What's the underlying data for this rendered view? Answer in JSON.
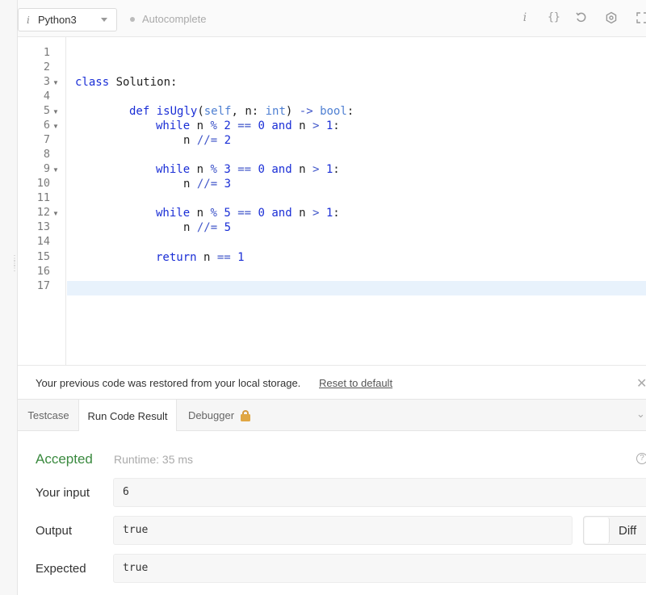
{
  "toolbar": {
    "language": "Python3",
    "autocomplete_label": "Autocomplete",
    "icons": [
      "info-icon",
      "braces-icon",
      "undo-icon",
      "settings-icon",
      "fullscreen-icon"
    ]
  },
  "editor": {
    "line_numbers": [
      "1",
      "2",
      "3",
      "4",
      "5",
      "6",
      "7",
      "8",
      "9",
      "10",
      "11",
      "12",
      "13",
      "14",
      "15",
      "16",
      "17"
    ],
    "folded_lines": [
      "3",
      "5",
      "6",
      "9",
      "12"
    ],
    "code": {
      "l3_kw": "class",
      "l3_name": "Solution:",
      "l5_kw": "def",
      "l5_fn": "isUgly",
      "l5_a": "(",
      "l5_self": "self",
      "l5_b": ", n: ",
      "l5_int": "int",
      "l5_c": ") ",
      "l5_arrow": "->",
      "l5_sp": " ",
      "l5_bool": "bool",
      "l5_colon": ":",
      "l6_while": "while",
      "l6_a": " n ",
      "l6_mod": "%",
      "l6_sp1": " ",
      "l6_two": "2",
      "l6_sp2": " ",
      "l6_eq": "==",
      "l6_sp3": " ",
      "l6_zero": "0",
      "l6_sp4": " ",
      "l6_and": "and",
      "l6_b": " n ",
      "l6_gt": ">",
      "l6_sp5": " ",
      "l6_one": "1",
      "l6_colon": ":",
      "l7_n": "n ",
      "l7_op": "//=",
      "l7_sp": " ",
      "l7_val": "2",
      "l9_while": "while",
      "l9_a": " n ",
      "l9_mod": "%",
      "l9_sp1": " ",
      "l9_three": "3",
      "l9_sp2": " ",
      "l9_eq": "==",
      "l9_sp3": " ",
      "l9_zero": "0",
      "l9_sp4": " ",
      "l9_and": "and",
      "l9_b": " n ",
      "l9_gt": ">",
      "l9_sp5": " ",
      "l9_one": "1",
      "l9_colon": ":",
      "l10_n": "n ",
      "l10_op": "//=",
      "l10_sp": " ",
      "l10_val": "3",
      "l12_while": "while",
      "l12_a": " n ",
      "l12_mod": "%",
      "l12_sp1": " ",
      "l12_five": "5",
      "l12_sp2": " ",
      "l12_eq": "==",
      "l12_sp3": " ",
      "l12_zero": "0",
      "l12_sp4": " ",
      "l12_and": "and",
      "l12_b": " n ",
      "l12_gt": ">",
      "l12_sp5": " ",
      "l12_one": "1",
      "l12_colon": ":",
      "l13_n": "n ",
      "l13_op": "//=",
      "l13_sp": " ",
      "l13_val": "5",
      "l15_return": "return",
      "l15_a": " n ",
      "l15_eq": "==",
      "l15_sp": " ",
      "l15_one": "1"
    }
  },
  "notice": {
    "text": "Your previous code was restored from your local storage.",
    "reset_link": "Reset to default"
  },
  "tabs": {
    "items": [
      {
        "label": "Testcase",
        "active": false
      },
      {
        "label": "Run Code Result",
        "active": true
      },
      {
        "label": "Debugger",
        "active": false,
        "locked": true
      }
    ]
  },
  "result": {
    "status": "Accepted",
    "status_color": "#3a8a3f",
    "runtime": "Runtime: 35 ms",
    "input_label": "Your input",
    "input_value": "6",
    "output_label": "Output",
    "output_value": "true",
    "expected_label": "Expected",
    "expected_value": "true",
    "diff_label": "Diff"
  }
}
